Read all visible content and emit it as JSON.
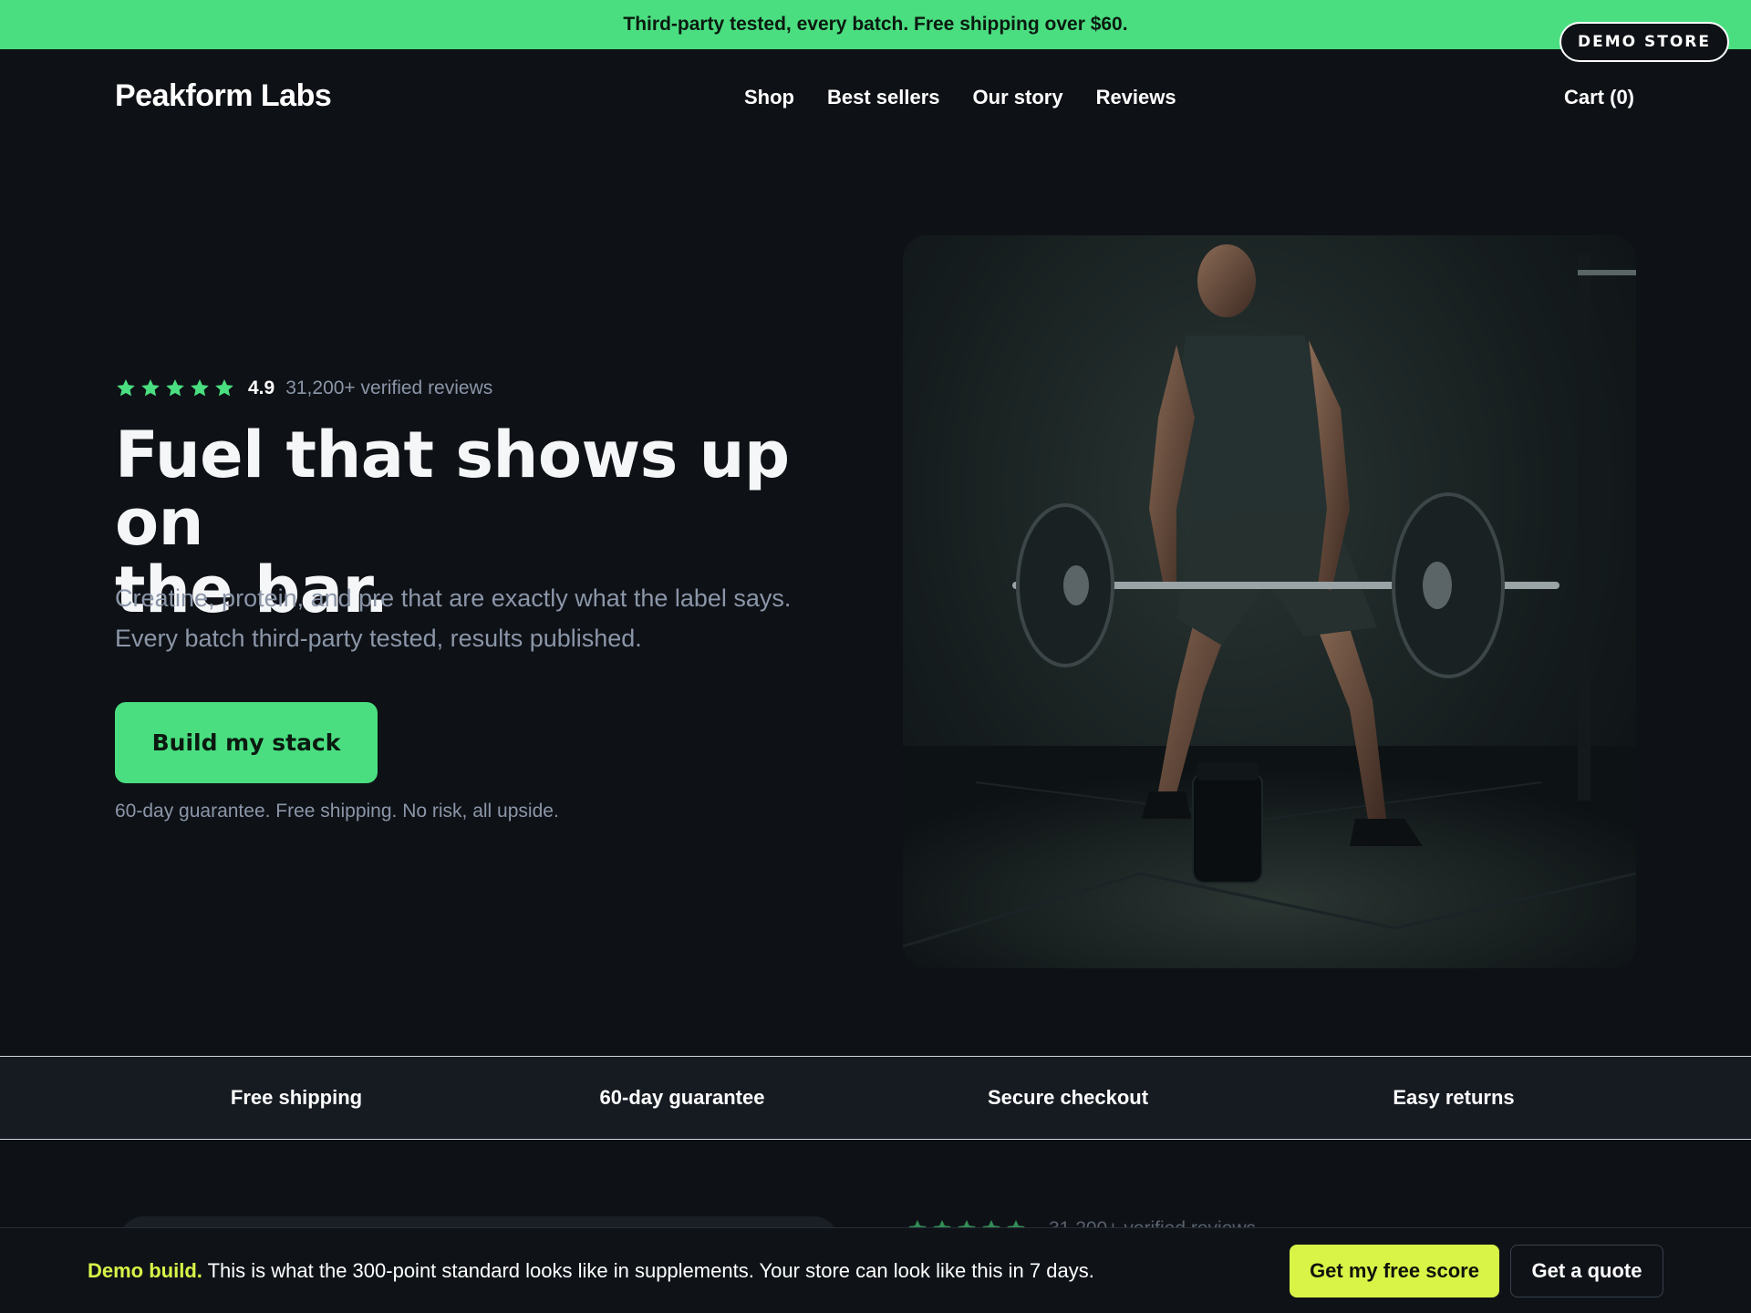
{
  "announcement": {
    "text": "Third-party tested, every batch. Free shipping over $60."
  },
  "demo_badge": {
    "label": "DEMO STORE"
  },
  "header": {
    "logo": "Peakform Labs",
    "nav": [
      {
        "label": "Shop"
      },
      {
        "label": "Best sellers"
      },
      {
        "label": "Our story"
      },
      {
        "label": "Reviews"
      }
    ],
    "cart_label": "Cart (0)"
  },
  "hero": {
    "rating": {
      "stars": 5,
      "score": "4.9",
      "count_text": "31,200+ verified reviews"
    },
    "headline_line1": "Fuel that shows up on",
    "headline_line2": "the bar.",
    "subhead_line1": "Creatine, protein, and pre that are exactly what the label says.",
    "subhead_line2": "Every batch third-party tested, results published.",
    "cta_label": "Build my stack",
    "guarantee": "60-day guarantee. Free shipping. No risk, all upside."
  },
  "trust_strip": {
    "items": [
      {
        "label": "Free shipping"
      },
      {
        "label": "60-day guarantee"
      },
      {
        "label": "Secure checkout"
      },
      {
        "label": "Easy returns"
      }
    ]
  },
  "peek": {
    "rating_text": "31,200+ verified reviews"
  },
  "demo_bar": {
    "highlight": "Demo build.",
    "text": " This is what the 300-point standard looks like in supplements. Your store can look like this in 7 days.",
    "primary_button": "Get my free score",
    "secondary_button": "Get a quote"
  },
  "colors": {
    "accent": "#4ade80",
    "background": "#0e1116",
    "demo_accent": "#d9f447",
    "muted_text": "#8b96a8"
  },
  "icons": {
    "rating_star": "star-icon"
  }
}
